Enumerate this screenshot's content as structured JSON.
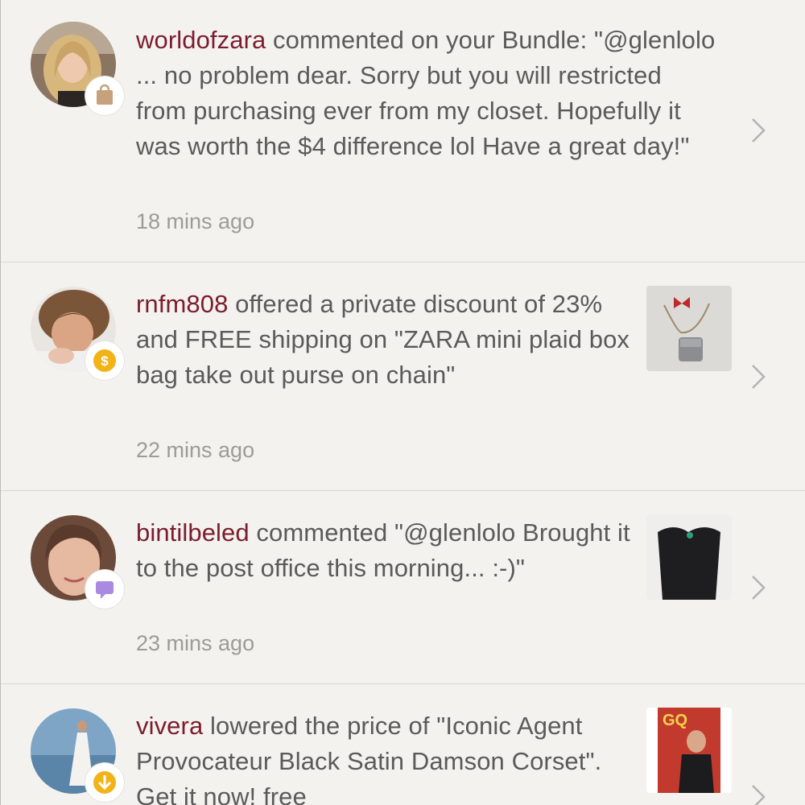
{
  "notifications": [
    {
      "username": "worldofzara",
      "message": " commented on your Bundle: \"@glenlolo ... no problem dear. Sorry but you will restricted from purchasing ever from my closet. Hopefully it was worth the $4 difference lol Have a great day!\"",
      "time": "18 mins ago",
      "badge_icon": "shopping-bag-icon",
      "badge_color": "#c6a27c",
      "has_thumbnail": false
    },
    {
      "username": "rnfm808",
      "message": " offered a private discount of 23% and FREE shipping on \"ZARA mini plaid box bag take out purse on chain\"",
      "time": "22 mins ago",
      "badge_icon": "dollar-coin-icon",
      "badge_color": "#f2b318",
      "has_thumbnail": true
    },
    {
      "username": "bintilbeled",
      "message": " commented \"@glenlolo Brought it to the post office this morning... :-)\"",
      "time": "23 mins ago",
      "badge_icon": "speech-bubble-icon",
      "badge_color": "#a98ae0",
      "has_thumbnail": true
    },
    {
      "username": "vivera",
      "message": " lowered the price of \"Iconic Agent Provocateur Black Satin Damson Corset\". Get it now! free",
      "time": "",
      "badge_icon": "down-arrow-icon",
      "badge_color": "#f2b318",
      "has_thumbnail": true
    }
  ],
  "colors": {
    "background": "#f3f2ef",
    "username": "#7b1d2c",
    "body_text": "#5b5a5a",
    "timestamp": "#9c9b98",
    "divider": "#d7d6d2"
  }
}
